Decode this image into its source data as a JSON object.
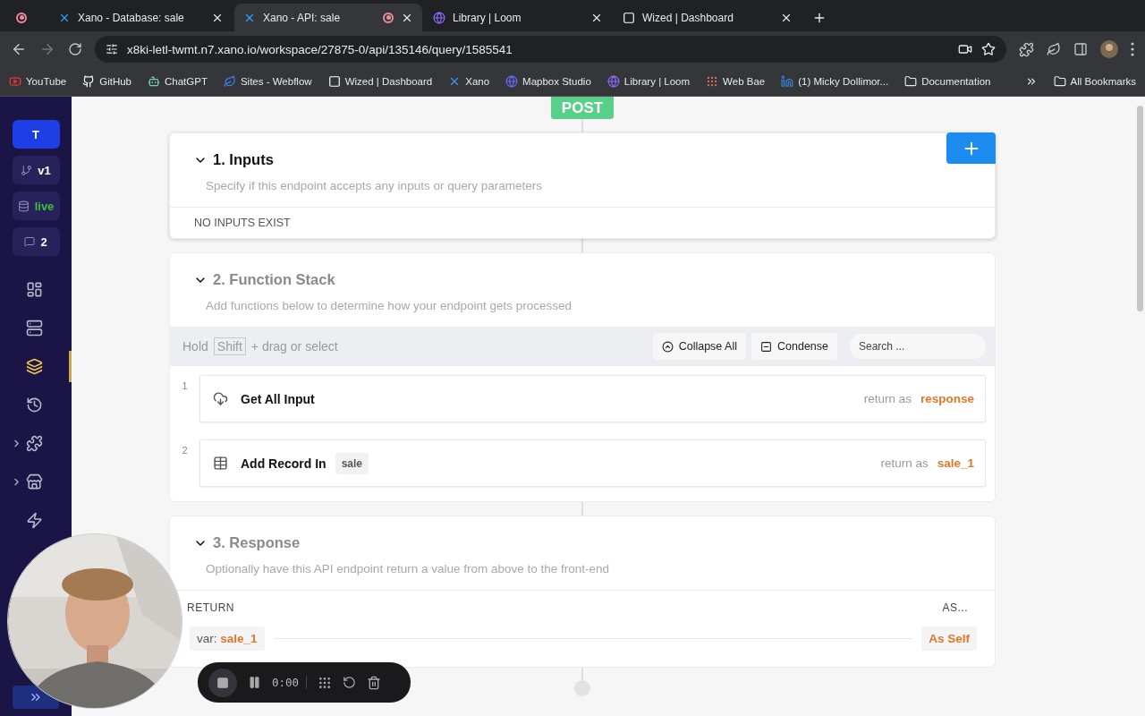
{
  "browser": {
    "tabs": [
      {
        "title": "Xano - Database: sale",
        "selected": false,
        "recording": false
      },
      {
        "title": "Xano - API: sale",
        "selected": true,
        "recording": true
      },
      {
        "title": "Library | Loom",
        "selected": false,
        "recording": false
      },
      {
        "title": "Wized | Dashboard",
        "selected": false,
        "recording": false
      }
    ],
    "url": "x8ki-letl-twmt.n7.xano.io/workspace/27875-0/api/135146/query/1585541",
    "bookmarks": [
      "YouTube",
      "GitHub",
      "ChatGPT",
      "Sites - Webflow",
      "Wized | Dashboard",
      "Xano",
      "Mapbox Studio",
      "Library | Loom",
      "Web Bae",
      "(1) Micky Dollimor..."
    ],
    "bookmark_folder": "Documentation",
    "all_bookmarks": "All Bookmarks"
  },
  "sidebar": {
    "workspace": "T",
    "branch": "v1",
    "datasource": "live",
    "comments": "2",
    "nav": [
      {
        "selected": false,
        "expandable": false
      },
      {
        "selected": false,
        "expandable": false
      },
      {
        "selected": true,
        "expandable": false
      },
      {
        "selected": false,
        "expandable": false
      },
      {
        "selected": false,
        "expandable": true
      },
      {
        "selected": false,
        "expandable": true
      },
      {
        "selected": false,
        "expandable": false
      }
    ]
  },
  "method": "POST",
  "inputs": {
    "title": "1. Inputs",
    "active": true,
    "subtitle": "Specify if this endpoint accepts any inputs or query parameters",
    "empty": "NO INPUTS EXIST"
  },
  "function_stack": {
    "title": "2. Function Stack",
    "active": false,
    "subtitle": "Add functions below to determine how your endpoint gets processed",
    "hint_before": "Hold",
    "hint_key": "Shift",
    "hint_after": "+ drag or select",
    "collapse": "Collapse All",
    "condense": "Condense",
    "search_placeholder": "Search ...",
    "steps": [
      {
        "number": "1",
        "kind": "input",
        "title": "Get All Input",
        "return_label": "return as",
        "return_var": "response"
      },
      {
        "number": "2",
        "kind": "record",
        "title": "Add Record In",
        "table": "sale",
        "return_label": "return as",
        "return_var": "sale_1"
      }
    ]
  },
  "response": {
    "title": "3. Response",
    "active": false,
    "subtitle": "Optionally have this API endpoint return a value from above to the front-end",
    "return_heading": "RETURN",
    "as_heading": "AS...",
    "var_prefix": "var:",
    "var_name": "sale_1",
    "as_value": "As Self"
  },
  "recorder": {
    "time": "0:00"
  }
}
